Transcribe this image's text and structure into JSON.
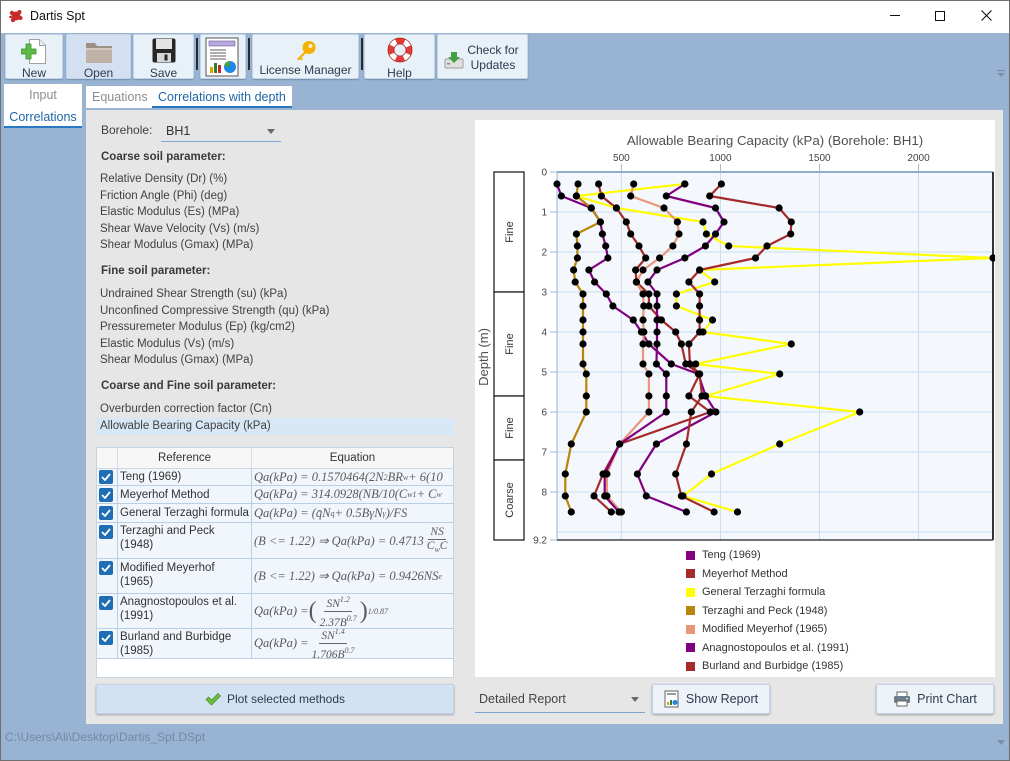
{
  "window": {
    "title": "Dartis Spt",
    "controls": [
      "minimize",
      "maximize",
      "close"
    ]
  },
  "toolbar": {
    "new": "New",
    "open": "Open",
    "save": "Save",
    "license_manager": "License Manager",
    "help": "Help",
    "check_updates": "Check for Updates"
  },
  "nav": {
    "input": "Input",
    "correlations": "Correlations",
    "selected": "Correlations"
  },
  "subtabs": {
    "equations": "Equations",
    "correlations_with_depth": "Correlations with depth",
    "selected": "Correlations with depth"
  },
  "parameters": {
    "borehole_label": "Borehole:",
    "borehole_value": "BH1",
    "coarse": {
      "heading": "Coarse soil parameter:",
      "items": [
        "Relative Density (Dr) (%)",
        "Friction Angle (Phi) (deg)",
        "Elastic Modulus (Es) (MPa)",
        "Shear Wave Velocity (Vs) (m/s)",
        "Shear Modulus (Gmax) (MPa)"
      ]
    },
    "fine": {
      "heading": "Fine soil parameter:",
      "items": [
        "Undrained Shear Strength (su) (kPa)",
        "Unconfined Compressive Strength (qu) (kPa)",
        "Pressuremeter Modulus (Ep) (kg/cm2)",
        "Elastic Modulus (Vs) (m/s)",
        "Shear Modulus (Gmax) (MPa)"
      ]
    },
    "coarse_fine": {
      "heading": "Coarse and Fine soil parameter:",
      "items": [
        "Overburden correction factor (Cn)",
        "Allowable Bearing Capacity (kPa)"
      ]
    },
    "selected_item": "Allowable Bearing Capacity (kPa)"
  },
  "methods_table": {
    "headers": {
      "check": "",
      "reference": "Reference",
      "equation": "Equation"
    },
    "rows": [
      {
        "checked": true,
        "reference": "Teng (1969)",
        "equation": [
          {
            "t": "Qa(kPa) = 0.1570464(2N"
          },
          {
            "t": "2",
            "k": "sup"
          },
          {
            "t": "BR"
          },
          {
            "t": "w",
            "k": "sub"
          },
          {
            "t": " + 6(10"
          }
        ]
      },
      {
        "checked": true,
        "reference": "Meyerhof Method",
        "equation": [
          {
            "t": "Qa(kPa) = 314.0928(NB/10(C"
          },
          {
            "t": "w1",
            "k": "sub"
          },
          {
            "t": " + C"
          },
          {
            "t": "w",
            "k": "sub"
          }
        ]
      },
      {
        "checked": true,
        "reference": "General Terzaghi formula",
        "equation": [
          {
            "t": "Qa(kPa) = (q̄N"
          },
          {
            "t": "q",
            "k": "sub"
          },
          {
            "t": " + 0.5BγN"
          },
          {
            "t": "γ",
            "k": "sub"
          },
          {
            "t": ")/FS"
          }
        ]
      },
      {
        "checked": true,
        "reference": "Terzaghi and Peck (1948)",
        "equation": [
          {
            "t": "(B <= 1.22) ⇒ Qa(kPa) = 0.4713"
          },
          {
            "k": "frac",
            "num": [
              {
                "t": "NS"
              }
            ],
            "den": [
              {
                "t": "C"
              },
              {
                "t": "w",
                "k": "sub"
              },
              {
                "t": "C"
              }
            ]
          }
        ]
      },
      {
        "checked": true,
        "reference": "Modified Meyerhof (1965)",
        "equation": [
          {
            "t": "(B <= 1.22) ⇒ Qa(kPa) = 0.9426NS"
          },
          {
            "t": "e",
            "k": "sub"
          }
        ]
      },
      {
        "checked": true,
        "reference": "Anagnostopoulos et al. (1991)",
        "equation": [
          {
            "t": "Qa(kPa) = "
          },
          {
            "t": "(",
            "k": "big"
          },
          {
            "k": "frac",
            "num": [
              {
                "t": "SN"
              },
              {
                "t": "1.2",
                "k": "sup"
              }
            ],
            "den": [
              {
                "t": "2.37B"
              },
              {
                "t": "0.7",
                "k": "sup"
              }
            ]
          },
          {
            "t": ")",
            "k": "big"
          },
          {
            "t": "1/0.87",
            "k": "sup"
          }
        ]
      },
      {
        "checked": true,
        "reference": "Burland and Burbidge (1985)",
        "equation": [
          {
            "t": "Qa(kPa) = "
          },
          {
            "k": "frac",
            "num": [
              {
                "t": "SN"
              },
              {
                "t": "1.4",
                "k": "sup"
              }
            ],
            "den": [
              {
                "t": "1.706B"
              },
              {
                "t": "0.7",
                "k": "sup"
              }
            ]
          }
        ]
      }
    ]
  },
  "plot_button": {
    "label": "Plot selected methods"
  },
  "report_controls": {
    "report_type": "Detailed Report",
    "show_report": "Show Report",
    "print_chart": "Print Chart"
  },
  "status_bar": {
    "file_path": "C:\\Users\\Ali\\Desktop\\Dartis_Spt.DSpt"
  },
  "theme": {
    "accent": "#1F66A8",
    "checkbox": "#1F6DB4",
    "app_background": "#98B4D2",
    "panel": "#E6E6E6"
  },
  "chart_data": {
    "type": "line",
    "title": "Allowable Bearing Capacity (kPa) (Borehole: BH1)",
    "xlabel": "",
    "ylabel": "Depth (m)",
    "x_axis_position": "top",
    "xlim": [
      175,
      2376
    ],
    "ylim": [
      0,
      9.2
    ],
    "y_inverted": true,
    "xticks": [
      500,
      1000,
      1500,
      2000
    ],
    "yticks": [
      0,
      1,
      2,
      3,
      4,
      5,
      6,
      7,
      8,
      9.2
    ],
    "grid": true,
    "legend_position": "bottom",
    "markers": "black dots",
    "depth": [
      0.3,
      0.6,
      0.9,
      1.25,
      1.55,
      1.85,
      2.15,
      2.45,
      2.75,
      3.05,
      3.35,
      3.7,
      4.0,
      4.3,
      4.8,
      5.05,
      5.6,
      6.0,
      6.8,
      7.55,
      8.1,
      8.5
    ],
    "series": [
      {
        "name": "Teng (1969)",
        "color": "#800080",
        "values": [
          175,
          197,
          348,
          394,
          404,
          421,
          432,
          336,
          365,
          424,
          457,
          560,
          601,
          639,
          752,
          889,
          925,
          977,
          677,
          581,
          626,
          828
        ]
      },
      {
        "name": "Meyerhof Method",
        "color": "#A52A2A",
        "values": [
          385,
          399,
          475,
          525,
          547,
          589,
          623,
          572,
          576,
          639,
          639,
          702,
          774,
          803,
          825,
          895,
          841,
          949,
          491,
          407,
          362,
          449
        ]
      },
      {
        "name": "General Terzaghi formula",
        "color": "#FFFF00",
        "values": [
          820,
          273,
          475,
          912,
          929,
          1042,
          2376,
          895,
          971,
          778,
          778,
          960,
          912,
          1358,
          875,
          1299,
          925,
          1703,
          1299,
          955,
          811,
          1086
        ]
      },
      {
        "name": "Terzaghi and Peck (1948)",
        "color": "#B8860B",
        "values": [
          281,
          273,
          348,
          394,
          273,
          278,
          278,
          259,
          267,
          306,
          306,
          306,
          306,
          306,
          306,
          323,
          323,
          323,
          247,
          217,
          217,
          247
        ]
      },
      {
        "name": "Modified Meyerhof (1965)",
        "color": "#E9967A",
        "values": [
          562,
          547,
          715,
          783,
          791,
          760,
          693,
          609,
          576,
          609,
          613,
          609,
          613,
          609,
          609,
          639,
          639,
          639,
          491,
          427,
          427,
          500
        ]
      },
      {
        "name": "Anagnostopoulos et al. (1991)",
        "color": "#800080",
        "values": [
          820,
          727,
          975,
          1018,
          975,
          924,
          820,
          680,
          634,
          680,
          680,
          680,
          680,
          680,
          677,
          727,
          727,
          727,
          491,
          416,
          416,
          488
        ]
      },
      {
        "name": "Burland and Burbidge (1985)",
        "color": "#A52A2A",
        "values": [
          1005,
          946,
          1296,
          1358,
          1355,
          1235,
          1177,
          895,
          841,
          895,
          895,
          895,
          895,
          841,
          846,
          895,
          907,
          853,
          828,
          774,
          803,
          968
        ]
      }
    ],
    "strata": [
      {
        "label": "Fine",
        "from": 0,
        "to": 3.0
      },
      {
        "label": "Fine",
        "from": 3.0,
        "to": 5.6
      },
      {
        "label": "Fine",
        "from": 5.6,
        "to": 7.2
      },
      {
        "label": "Coarse",
        "from": 7.2,
        "to": 9.2
      }
    ]
  }
}
